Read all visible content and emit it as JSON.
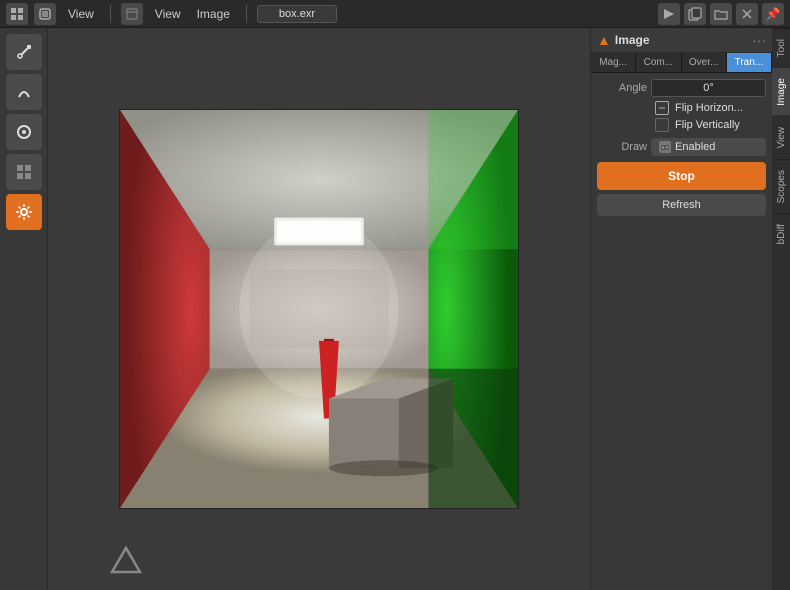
{
  "topbar": {
    "menus": [
      "View",
      "View",
      "Image"
    ],
    "filename": "box.exr",
    "pin_icon": "📌"
  },
  "leftToolbar": {
    "tools": [
      {
        "id": "eyedropper",
        "icon": "✏",
        "active": false
      },
      {
        "id": "sample",
        "icon": "〜",
        "active": false
      },
      {
        "id": "circle",
        "icon": "◎",
        "active": false
      },
      {
        "id": "grid",
        "icon": "▦",
        "active": false
      },
      {
        "id": "settings",
        "icon": "⚙",
        "active": true
      }
    ]
  },
  "rightPanel": {
    "title": "Image",
    "icon": "▲",
    "dotsLabel": "···",
    "subtabs": [
      {
        "id": "mag",
        "label": "Mag...",
        "active": false
      },
      {
        "id": "com",
        "label": "Com...",
        "active": false
      },
      {
        "id": "over",
        "label": "Over...",
        "active": false
      },
      {
        "id": "tran",
        "label": "Tran...",
        "active": true
      }
    ],
    "angle": {
      "label": "Angle",
      "value": "0°"
    },
    "flipHorizontal": {
      "label": "Flip Horizon...",
      "checked": false
    },
    "flipVertical": {
      "label": "Flip Vertically",
      "checked": false
    },
    "draw": {
      "label": "Draw",
      "status": "Enabled"
    },
    "stopButton": "Stop",
    "refreshButton": "Refresh"
  },
  "sideTabs": [
    {
      "id": "tool",
      "label": "Tool",
      "active": false
    },
    {
      "id": "image",
      "label": "Image",
      "active": true
    },
    {
      "id": "view",
      "label": "View",
      "active": false
    },
    {
      "id": "scopes",
      "label": "Scopes",
      "active": false
    },
    {
      "id": "bdiff",
      "label": "bDiff",
      "active": false
    }
  ]
}
